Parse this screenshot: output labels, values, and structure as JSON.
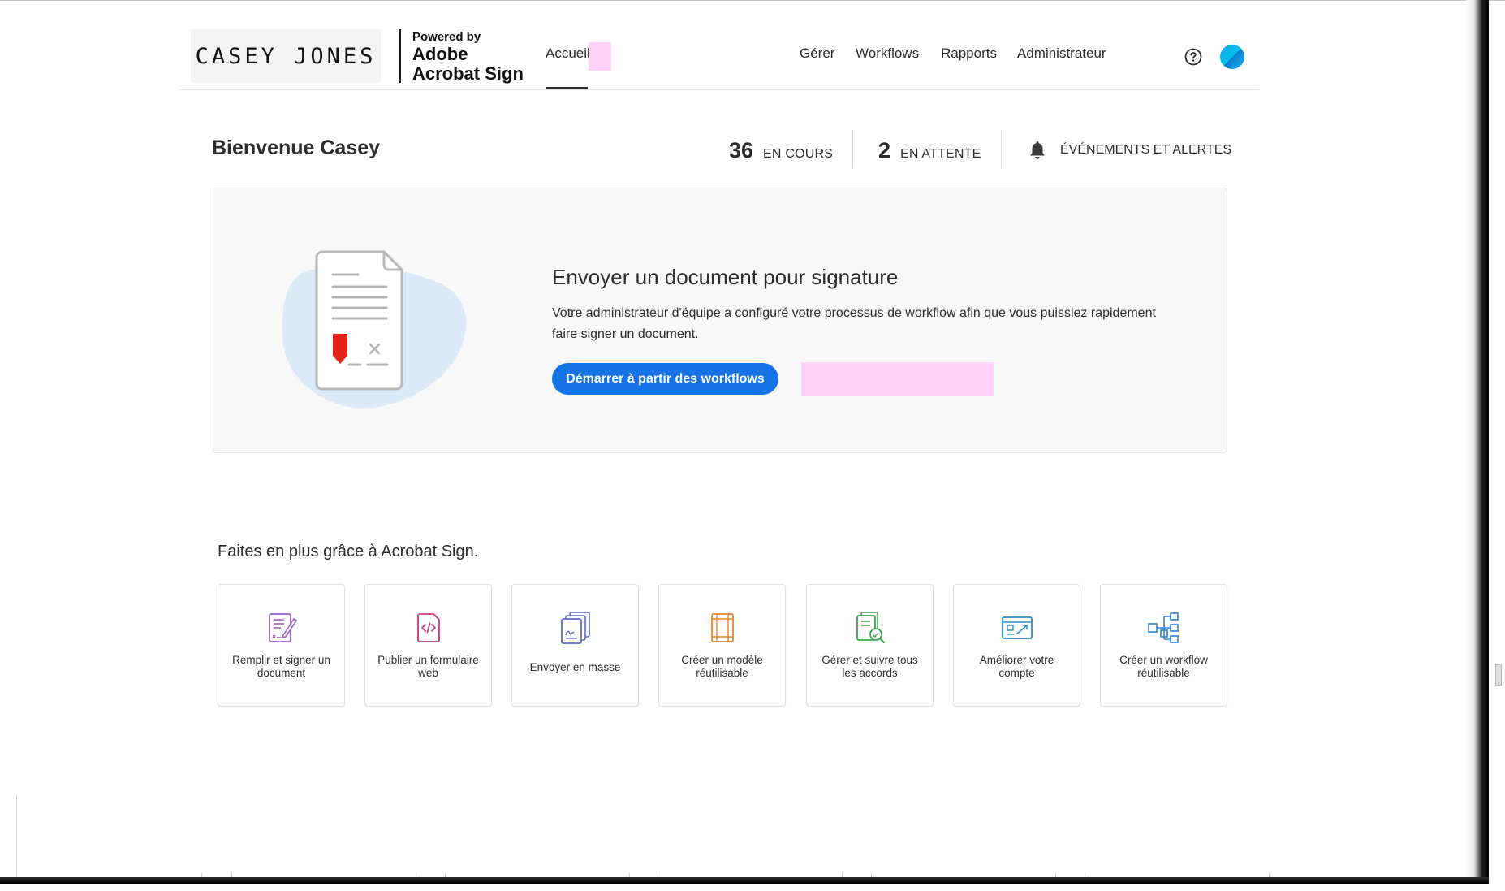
{
  "header": {
    "brand_name": "CASEY JONES",
    "powered_by": "Powered by",
    "adobe": "Adobe",
    "acrobat_sign": "Acrobat Sign",
    "nav": [
      {
        "label": "Accueil",
        "active": true
      },
      {
        "label": "Gérer"
      },
      {
        "label": "Workflows"
      },
      {
        "label": "Rapports"
      },
      {
        "label": "Administrateur"
      }
    ],
    "help_icon": "help-circle-icon",
    "avatar_icon": "avatar"
  },
  "welcome": {
    "greeting": "Bienvenue Casey",
    "in_progress_count": "36",
    "in_progress_label": "EN COURS",
    "waiting_count": "2",
    "waiting_label": "EN ATTENTE",
    "alerts_label": "ÉVÉNEMENTS ET ALERTES",
    "bell_icon": "bell-icon"
  },
  "hero": {
    "title": "Envoyer un document pour signature",
    "description": "Votre administrateur d'équipe a configuré votre processus de workflow afin que vous puissiez rapidement faire signer un document.",
    "button_label": "Démarrer à partir des workflows",
    "illustration": "document-signature-icon"
  },
  "more": {
    "title": "Faites en plus grâce à Acrobat Sign.",
    "tiles": [
      {
        "label": "Remplir et signer un document",
        "icon": "fill-sign-icon"
      },
      {
        "label": "Publier un formulaire web",
        "icon": "web-form-icon"
      },
      {
        "label": "Envoyer en masse",
        "icon": "bulk-send-icon"
      },
      {
        "label": "Créer un modèle réutilisable",
        "icon": "template-icon"
      },
      {
        "label": "Gérer et suivre tous les accords",
        "icon": "manage-agreements-icon"
      },
      {
        "label": "Améliorer votre compte",
        "icon": "upgrade-account-icon"
      },
      {
        "label": "Créer un workflow réutilisable",
        "icon": "workflow-icon"
      }
    ]
  },
  "colors": {
    "accent_blue": "#1473e6",
    "text": "#2c2c2c",
    "redaction_pink": "#ffd0f8",
    "card_background": "#f8f8f8"
  }
}
